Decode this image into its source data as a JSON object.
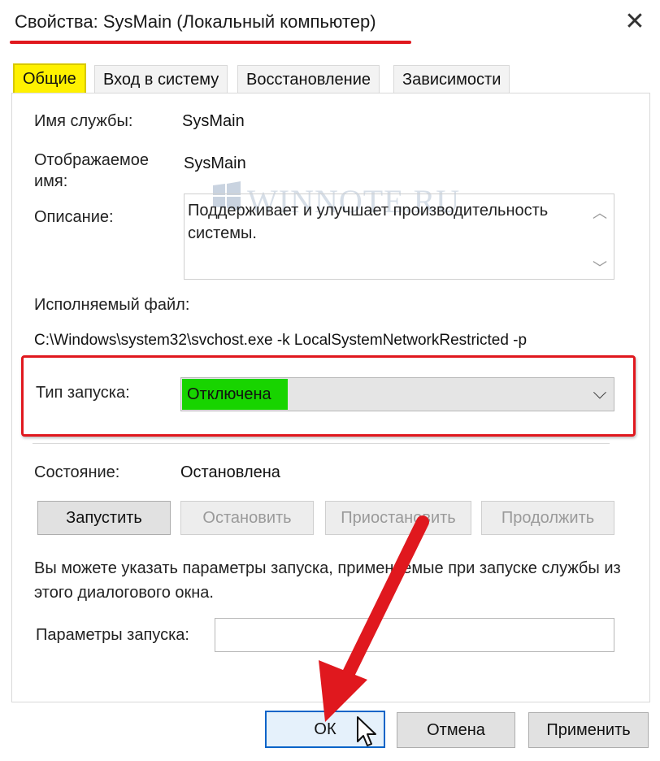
{
  "window": {
    "title": "Свойства: SysMain (Локальный компьютер)",
    "close_glyph": "✕"
  },
  "tabs": [
    {
      "label": "Общие"
    },
    {
      "label": "Вход в систему"
    },
    {
      "label": "Восстановление"
    },
    {
      "label": "Зависимости"
    }
  ],
  "general": {
    "service_name_label": "Имя службы:",
    "service_name_value": "SysMain",
    "display_name_label_1": "Отображаемое",
    "display_name_label_2": "имя:",
    "display_name_value": "SysMain",
    "description_label": "Описание:",
    "description_value": "Поддерживает и улучшает производительность системы.",
    "executable_label": "Исполняемый файл:",
    "executable_value": "C:\\Windows\\system32\\svchost.exe -k LocalSystemNetworkRestricted -p",
    "startup_type_label": "Тип запуска:",
    "startup_type_value": "Отключена",
    "status_label": "Состояние:",
    "status_value": "Остановлена",
    "buttons": {
      "start": "Запустить",
      "stop": "Остановить",
      "pause": "Приостановить",
      "resume": "Продолжить"
    },
    "hint_text": "Вы можете указать параметры запуска, применяемые при запуске службы из этого диалогового окна.",
    "start_params_label": "Параметры запуска:",
    "start_params_value": ""
  },
  "footer": {
    "ok": "ОК",
    "cancel": "Отмена",
    "apply": "Применить"
  },
  "watermark": "WINNOTE.RU",
  "colors": {
    "highlight_red": "#e0181e",
    "tab_yellow": "#fff100",
    "startup_green": "#18d400"
  }
}
